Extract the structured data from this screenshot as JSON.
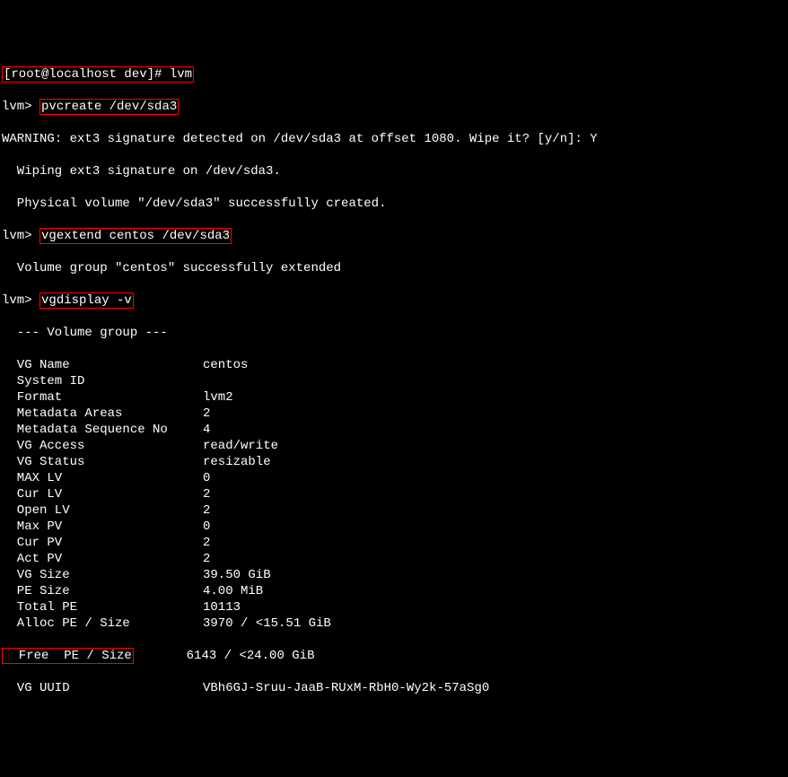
{
  "prompt1": {
    "text": "[root@localhost dev]# ",
    "cmd": "lvm"
  },
  "prompt2": {
    "text": "lvm> ",
    "cmd": "pvcreate /dev/sda3"
  },
  "warning": "WARNING: ext3 signature detected on /dev/sda3 at offset 1080. Wipe it? [y/n]: Y",
  "wiping": "  Wiping ext3 signature on /dev/sda3.",
  "pvcreated": "  Physical volume \"/dev/sda3\" successfully created.",
  "prompt3": {
    "text": "lvm> ",
    "cmd": "vgextend centos /dev/sda3"
  },
  "vgextended": "  Volume group \"centos\" successfully extended",
  "prompt4": {
    "text": "lvm> ",
    "cmd": "vgdisplay -v"
  },
  "vg_header": "  --- Volume group ---",
  "fields": [
    {
      "label": "  VG Name",
      "value": "centos"
    },
    {
      "label": "  System ID",
      "value": ""
    },
    {
      "label": "  Format",
      "value": "lvm2"
    },
    {
      "label": "  Metadata Areas",
      "value": "2"
    },
    {
      "label": "  Metadata Sequence No",
      "value": "4"
    },
    {
      "label": "  VG Access",
      "value": "read/write"
    },
    {
      "label": "  VG Status",
      "value": "resizable"
    },
    {
      "label": "  MAX LV",
      "value": "0"
    },
    {
      "label": "  Cur LV",
      "value": "2"
    },
    {
      "label": "  Open LV",
      "value": "2"
    },
    {
      "label": "  Max PV",
      "value": "0"
    },
    {
      "label": "  Cur PV",
      "value": "2"
    },
    {
      "label": "  Act PV",
      "value": "2"
    },
    {
      "label": "  VG Size",
      "value": "39.50 GiB"
    },
    {
      "label": "  PE Size",
      "value": "4.00 MiB"
    },
    {
      "label": "  Total PE",
      "value": "10113"
    },
    {
      "label": "  Alloc PE / Size",
      "value": "3970 / <15.51 GiB"
    }
  ],
  "free_pe": {
    "label": "  Free  PE / Size",
    "value": "6143 / <24.00 GiB"
  },
  "vg_uuid": {
    "label": "  VG UUID",
    "value": "VBh6GJ-Sruu-JaaB-RUxM-RbH0-Wy2k-57aSg0"
  }
}
